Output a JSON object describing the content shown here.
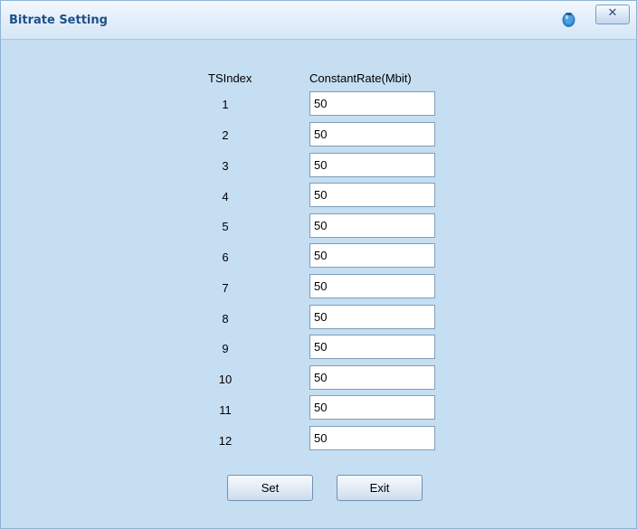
{
  "window": {
    "title": "Bitrate Setting",
    "close_label": "✕"
  },
  "table": {
    "col_index_header": "TSIndex",
    "col_rate_header": "ConstantRate(Mbit)",
    "rows": [
      {
        "index": "1",
        "rate": "50"
      },
      {
        "index": "2",
        "rate": "50"
      },
      {
        "index": "3",
        "rate": "50"
      },
      {
        "index": "4",
        "rate": "50"
      },
      {
        "index": "5",
        "rate": "50"
      },
      {
        "index": "6",
        "rate": "50"
      },
      {
        "index": "7",
        "rate": "50"
      },
      {
        "index": "8",
        "rate": "50"
      },
      {
        "index": "9",
        "rate": "50"
      },
      {
        "index": "10",
        "rate": "50"
      },
      {
        "index": "11",
        "rate": "50"
      },
      {
        "index": "12",
        "rate": "50"
      }
    ]
  },
  "buttons": {
    "set_label": "Set",
    "exit_label": "Exit"
  },
  "icons": {
    "help": "help-icon",
    "close": "close-icon"
  },
  "colors": {
    "window_bg": "#c6def2",
    "title_text": "#1f4f8a"
  }
}
